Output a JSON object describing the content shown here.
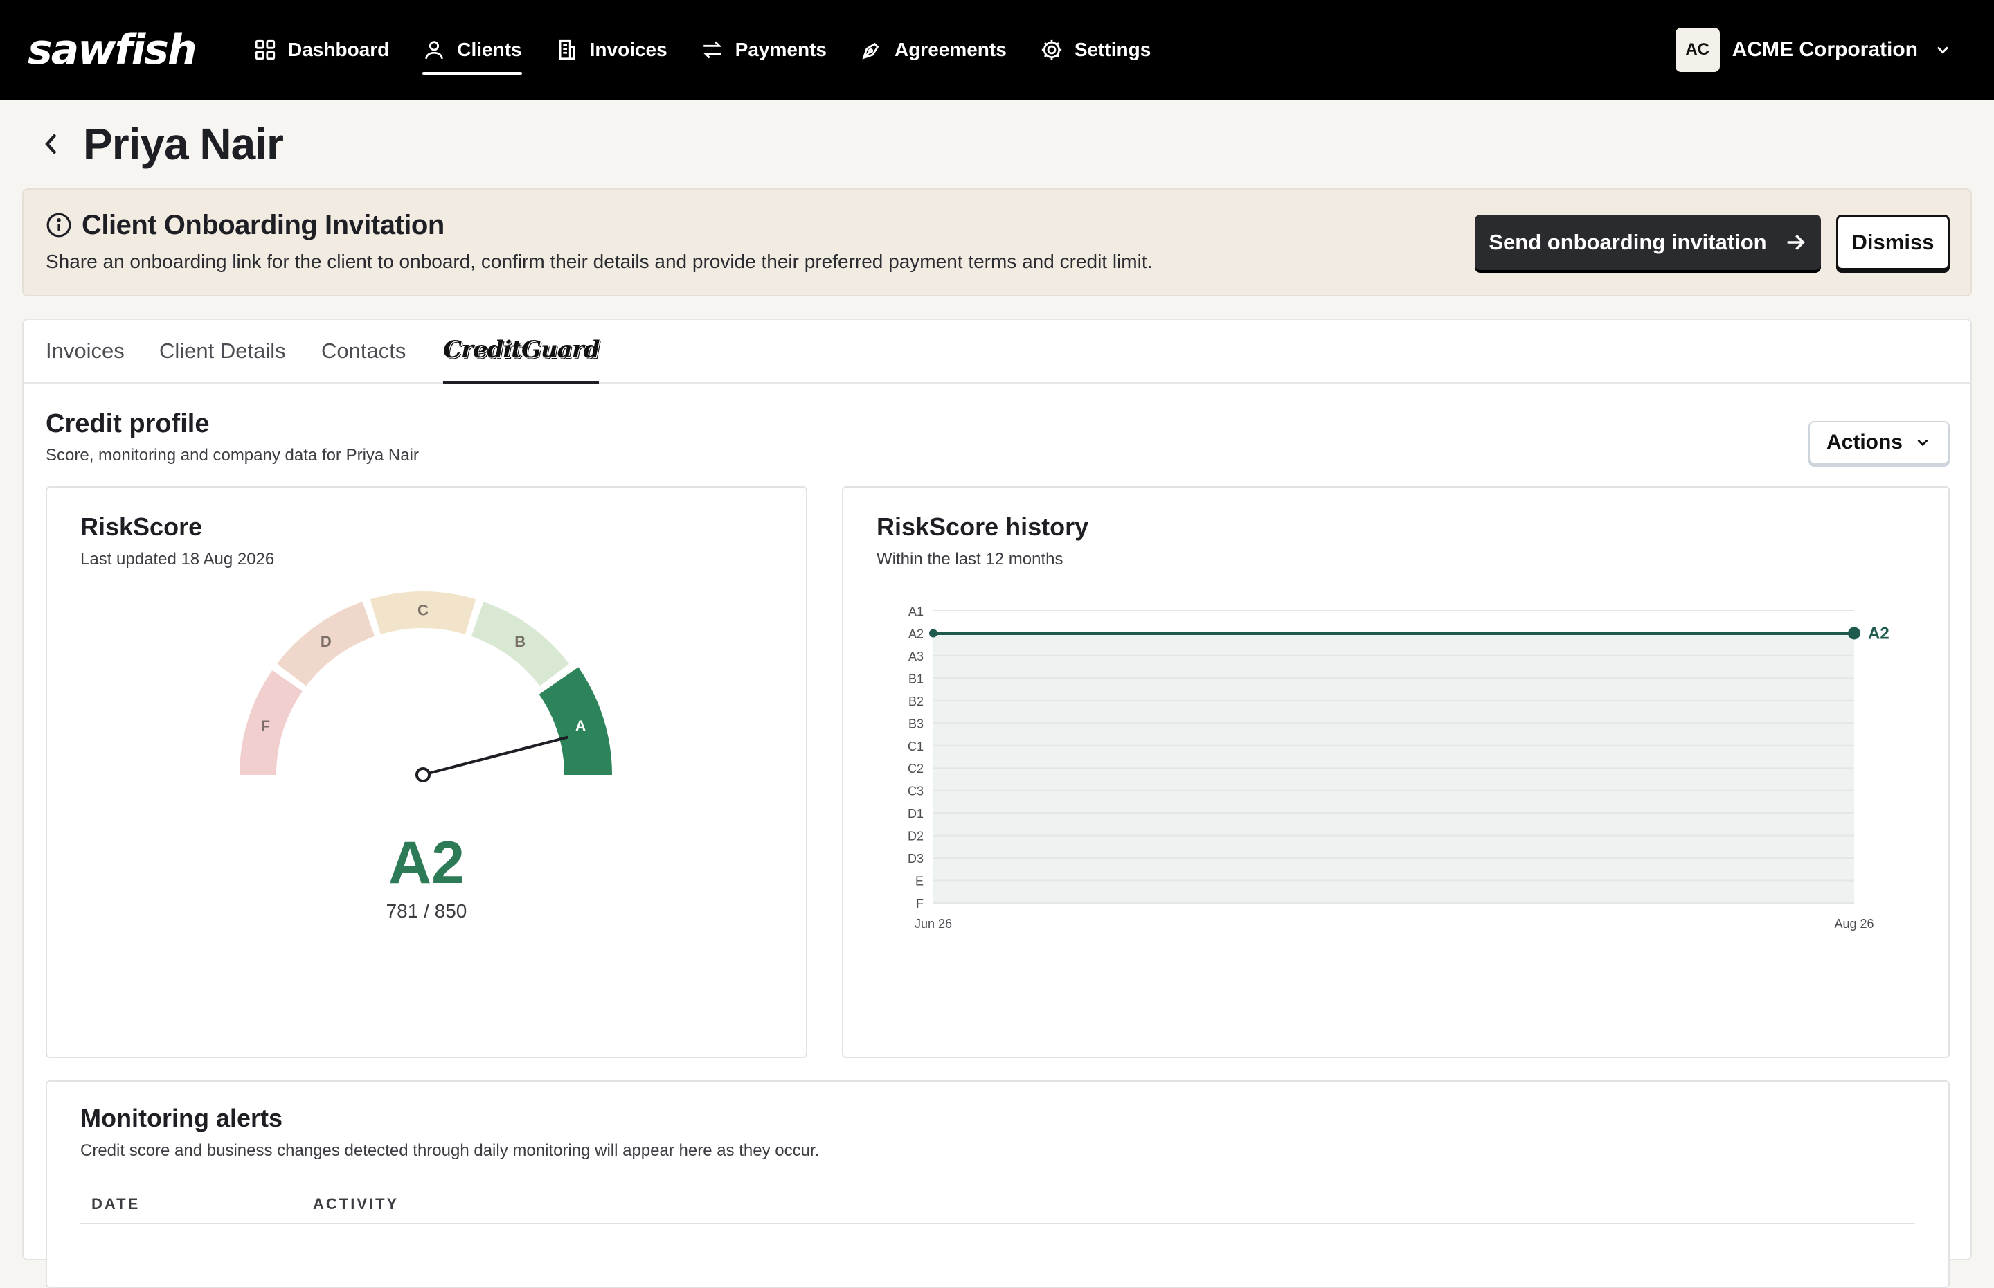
{
  "nav": {
    "brand": "sawfish",
    "items": [
      {
        "label": "Dashboard",
        "icon": "dashboard-icon",
        "active": false
      },
      {
        "label": "Clients",
        "icon": "user-icon",
        "active": true
      },
      {
        "label": "Invoices",
        "icon": "invoice-icon",
        "active": false
      },
      {
        "label": "Payments",
        "icon": "arrows-icon",
        "active": false
      },
      {
        "label": "Agreements",
        "icon": "pen-icon",
        "active": false
      },
      {
        "label": "Settings",
        "icon": "gear-icon",
        "active": false
      }
    ],
    "org": {
      "initials": "AC",
      "name": "ACME Corporation"
    }
  },
  "page": {
    "title": "Priya Nair"
  },
  "banner": {
    "title": "Client Onboarding Invitation",
    "text": "Share an onboarding link for the client to onboard, confirm their details and provide their preferred payment terms and credit limit.",
    "primary_label": "Send onboarding invitation",
    "dismiss_label": "Dismiss"
  },
  "tabs": [
    {
      "label": "Invoices",
      "active": false
    },
    {
      "label": "Client Details",
      "active": false
    },
    {
      "label": "Contacts",
      "active": false
    },
    {
      "label": "CreditGuard",
      "active": true
    }
  ],
  "credit_profile": {
    "title": "Credit profile",
    "subtitle": "Score, monitoring and company data for Priya Nair",
    "actions_label": "Actions"
  },
  "riskscore": {
    "title": "RiskScore",
    "updated": "Last updated 18 Aug 2026",
    "grade": "A2",
    "score_text": "781 / 850",
    "score": 781,
    "max": 850,
    "bands": [
      {
        "label": "F",
        "color": "#f2cfcf"
      },
      {
        "label": "D",
        "color": "#f0d7cb"
      },
      {
        "label": "C",
        "color": "#f2e4cb"
      },
      {
        "label": "B",
        "color": "#d9e8d3"
      },
      {
        "label": "A",
        "color": "#2e845a"
      }
    ]
  },
  "history": {
    "title": "RiskScore history",
    "subtitle": "Within the last 12 months"
  },
  "chart_data": {
    "type": "line",
    "title": "RiskScore history",
    "y_categories": [
      "A1",
      "A2",
      "A3",
      "B1",
      "B2",
      "B3",
      "C1",
      "C2",
      "C3",
      "D1",
      "D2",
      "D3",
      "E",
      "F"
    ],
    "x_labels": [
      "Jun 26",
      "Aug 26"
    ],
    "series": [
      {
        "values": [
          "A2",
          "A2"
        ],
        "end_label": "A2",
        "color": "#1f5a4f"
      }
    ],
    "grid": true
  },
  "alerts": {
    "title": "Monitoring alerts",
    "subtitle": "Credit score and business changes detected through daily monitoring will appear here as they occur.",
    "columns": [
      "DATE",
      "ACTIVITY"
    ]
  }
}
